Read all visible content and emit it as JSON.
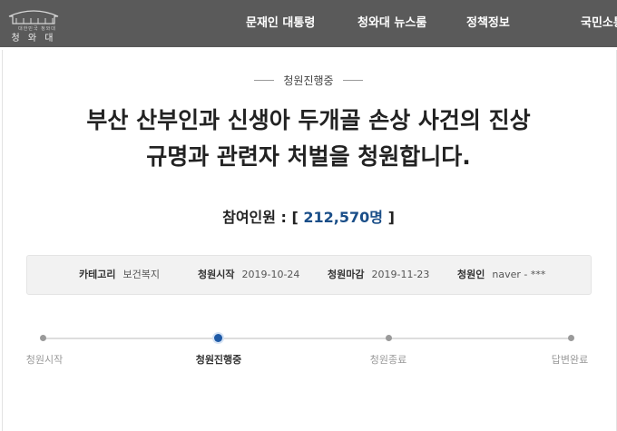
{
  "header": {
    "logo_small": "대한민국 청와대",
    "logo_text": "청 와 대",
    "nav": [
      "문재인 대통령",
      "청와대 뉴스룸",
      "정책정보",
      "국민소통"
    ]
  },
  "petition": {
    "status": "청원진행중",
    "title_line1": "부산 산부인과 신생아 두개골 손상 사건의 진상",
    "title_line2": "규명과 관련자 처벌을 청원합니다.",
    "count_label": "참여인원 : [",
    "count_value": "212,570명",
    "count_close": " ]",
    "info": [
      {
        "label": "카테고리",
        "value": "보건복지"
      },
      {
        "label": "청원시작",
        "value": "2019-10-24"
      },
      {
        "label": "청원마감",
        "value": "2019-11-23"
      },
      {
        "label": "청원인",
        "value": "naver - ***"
      }
    ]
  },
  "progress": {
    "steps": [
      "청원시작",
      "청원진행중",
      "청원종료",
      "답변완료"
    ],
    "active_index": 1
  },
  "colors": {
    "topbar": "#5a5a5a",
    "accent": "#1f5aa6",
    "count": "#1a4e88"
  }
}
